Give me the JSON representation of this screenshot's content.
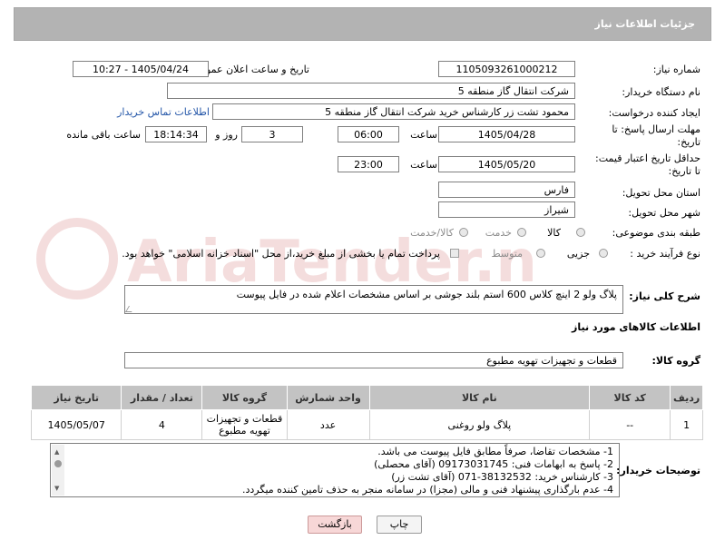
{
  "header": {
    "title": "جزئیات اطلاعات نیاز"
  },
  "form": {
    "need_number_label": "شماره نیاز:",
    "need_number": "1105093261000212",
    "announce_label": "تاریخ و ساعت اعلان عمومی:",
    "announce_value": "1405/04/24 - 10:27",
    "buyer_org_label": "نام دستگاه خریدار:",
    "buyer_org": "شرکت انتقال گاز منطقه 5",
    "creator_label": "ایجاد کننده درخواست:",
    "creator": "محمود تشت زر کارشناس خرید شرکت انتقال گاز منطقه 5",
    "contact_link": "اطلاعات تماس خریدار",
    "reply_deadline_label_1": "مهلت ارسال پاسخ: تا",
    "reply_deadline_label_2": "تاریخ:",
    "reply_date": "1405/04/28",
    "time_label": "ساعت",
    "reply_time": "06:00",
    "days_count": "3",
    "days_label": "روز و",
    "remaining_time": "18:14:34",
    "remaining_label": "ساعت باقی مانده",
    "price_valid_label_1": "حداقل تاریخ اعتبار قیمت:",
    "price_valid_label_2": "تا تاریخ:",
    "price_valid_date": "1405/05/20",
    "price_valid_time": "23:00",
    "province_label": "استان محل تحویل:",
    "province": "فارس",
    "city_label": "شهر محل تحویل:",
    "city": "شیراز",
    "category_label": "طبقه بندی موضوعی:",
    "category_options": [
      "کالا",
      "خدمت",
      "کالا/خدمت"
    ],
    "process_label": "نوع فرآیند خرید :",
    "process_options": [
      "جزیی",
      "متوسط"
    ],
    "payment_note": "پرداخت تمام یا بخشی از مبلغ خرید،از محل \"اسناد خزانه اسلامی\" خواهد بود."
  },
  "description": {
    "label": "شرح کلی نیاز:",
    "text": "پلاگ ولو 2 اینچ کلاس 600 استم بلند جوشی بر اساس مشخصات اعلام شده در فایل پیوست"
  },
  "goods": {
    "section_title": "اطلاعات کالاهای مورد نیاز",
    "group_label": "گروه کالا:",
    "group_value": "قطعات و تجهیزات تهویه مطبوع",
    "columns": [
      "ردیف",
      "کد کالا",
      "نام کالا",
      "واحد شمارش",
      "گروه کالا",
      "تعداد / مقدار",
      "تاریخ نیاز"
    ],
    "rows": [
      [
        "1",
        "--",
        "پلاگ ولو روغنی",
        "عدد",
        "قطعات و تجهیزات تهویه مطبوع",
        "4",
        "1405/05/07"
      ]
    ]
  },
  "buyer_notes": {
    "label": "توضیحات خریدار:",
    "lines": [
      "1-  مشخصات تقاضا، صرفاً مطابق فایل پیوست می باشد.",
      "2- پاسخ به ابهامات فنی: 09173031745 (آقای محصلی)",
      "3- کارشناس خرید: 38132532-071 (آقای تشت زر)",
      "4- عدم بارگذاری پیشنهاد فنی و مالی (مجزا) در سامانه منجر به حذف تامین کننده میگردد."
    ]
  },
  "buttons": {
    "print": "چاپ",
    "back": "بازگشت"
  },
  "watermark": {
    "text": "AriaTender.neT"
  }
}
